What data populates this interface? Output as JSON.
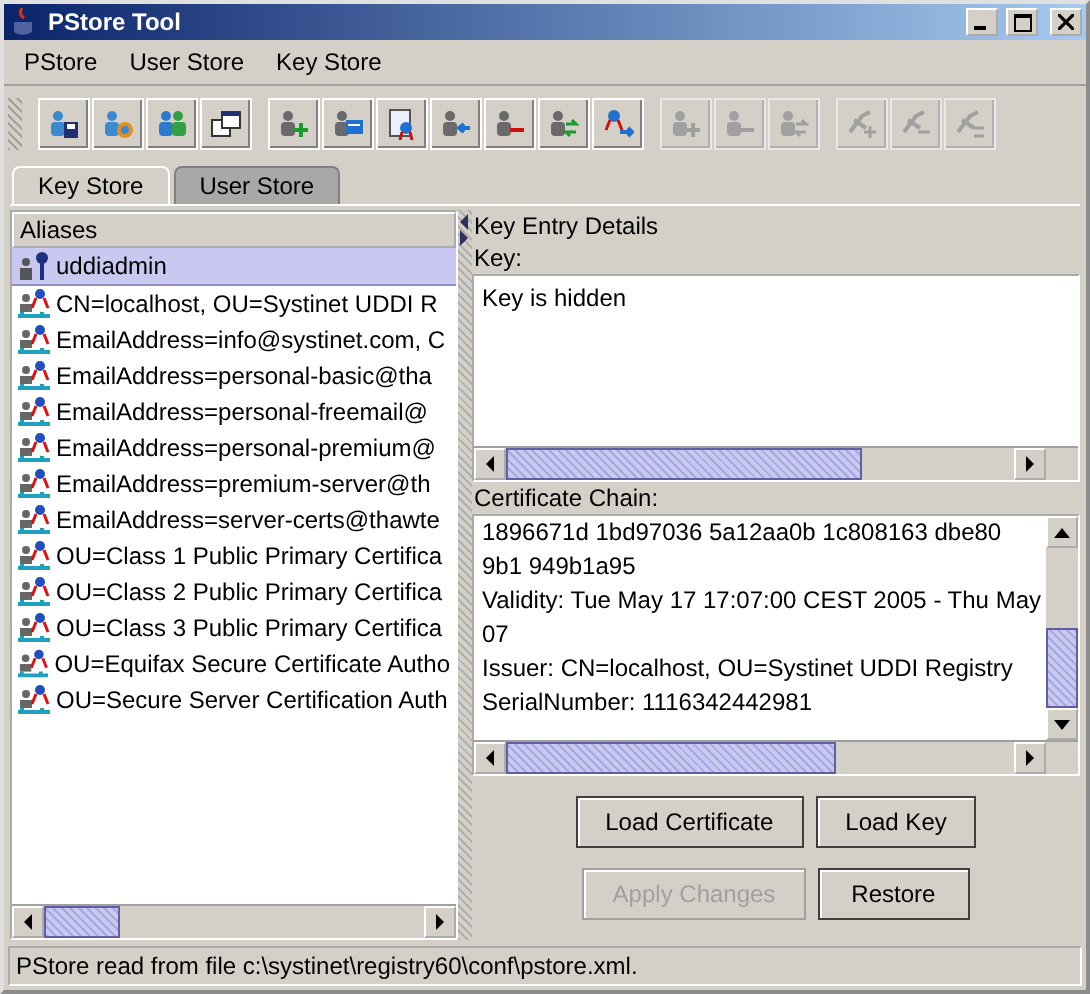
{
  "window": {
    "title": "PStore Tool"
  },
  "menu": [
    "PStore",
    "User Store",
    "Key Store"
  ],
  "toolbar": [
    [
      {
        "kind": "user-save",
        "disabled": false
      },
      {
        "kind": "user-globe",
        "disabled": false
      },
      {
        "kind": "users",
        "disabled": false
      },
      {
        "kind": "windows",
        "disabled": false
      }
    ],
    [
      {
        "kind": "user-add",
        "disabled": false
      },
      {
        "kind": "user-card",
        "disabled": false
      },
      {
        "kind": "certificate",
        "disabled": false
      },
      {
        "kind": "user-import",
        "disabled": false
      },
      {
        "kind": "user-remove",
        "disabled": false
      },
      {
        "kind": "user-swap",
        "disabled": false
      },
      {
        "kind": "cert-export",
        "disabled": false
      }
    ],
    [
      {
        "kind": "user-add",
        "disabled": true
      },
      {
        "kind": "user-remove",
        "disabled": true
      },
      {
        "kind": "user-swap",
        "disabled": true
      }
    ],
    [
      {
        "kind": "key-add",
        "disabled": true
      },
      {
        "kind": "key-remove",
        "disabled": true
      },
      {
        "kind": "key-swap",
        "disabled": true
      }
    ]
  ],
  "tabs": [
    {
      "label": "Key Store",
      "selected": true
    },
    {
      "label": "User Store",
      "selected": false
    }
  ],
  "aliases": {
    "header": "Aliases",
    "items": [
      {
        "label": "uddiadmin",
        "kind": "key",
        "selected": true
      },
      {
        "label": "CN=localhost, OU=Systinet UDDI R",
        "kind": "cert",
        "selected": false
      },
      {
        "label": "EmailAddress=info@systinet.com, C",
        "kind": "cert",
        "selected": false
      },
      {
        "label": "EmailAddress=personal-basic@tha",
        "kind": "cert",
        "selected": false
      },
      {
        "label": "EmailAddress=personal-freemail@",
        "kind": "cert",
        "selected": false
      },
      {
        "label": "EmailAddress=personal-premium@",
        "kind": "cert",
        "selected": false
      },
      {
        "label": "EmailAddress=premium-server@th",
        "kind": "cert",
        "selected": false
      },
      {
        "label": "EmailAddress=server-certs@thawte",
        "kind": "cert",
        "selected": false
      },
      {
        "label": "OU=Class 1 Public Primary Certifica",
        "kind": "cert",
        "selected": false
      },
      {
        "label": "OU=Class 2 Public Primary Certifica",
        "kind": "cert",
        "selected": false
      },
      {
        "label": "OU=Class 3 Public Primary Certifica",
        "kind": "cert",
        "selected": false
      },
      {
        "label": "OU=Equifax Secure Certificate Autho",
        "kind": "cert",
        "selected": false
      },
      {
        "label": "OU=Secure Server Certification Auth",
        "kind": "cert",
        "selected": false
      }
    ]
  },
  "details": {
    "title": "Key Entry Details",
    "key_label": "Key:",
    "key_text": "Key is hidden",
    "chain_label": "Certificate Chain:",
    "chain_lines": [
      "1896671d 1bd97036 5a12aa0b 1c808163 dbe80",
      "9b1 949b1a95",
      "Validity: Tue May 17 17:07:00 CEST 2005 - Thu May",
      "07",
      "Issuer: CN=localhost, OU=Systinet UDDI Registry",
      "SerialNumber: 1116342442981"
    ]
  },
  "buttons": [
    [
      {
        "label": "Load Certificate",
        "disabled": false
      },
      {
        "label": "Load Key",
        "disabled": false
      }
    ],
    [
      {
        "label": "Apply Changes",
        "disabled": true
      },
      {
        "label": "Restore",
        "disabled": false
      }
    ]
  ],
  "status_bar": "PStore read from file c:\\systinet\\registry60\\conf\\pstore.xml."
}
